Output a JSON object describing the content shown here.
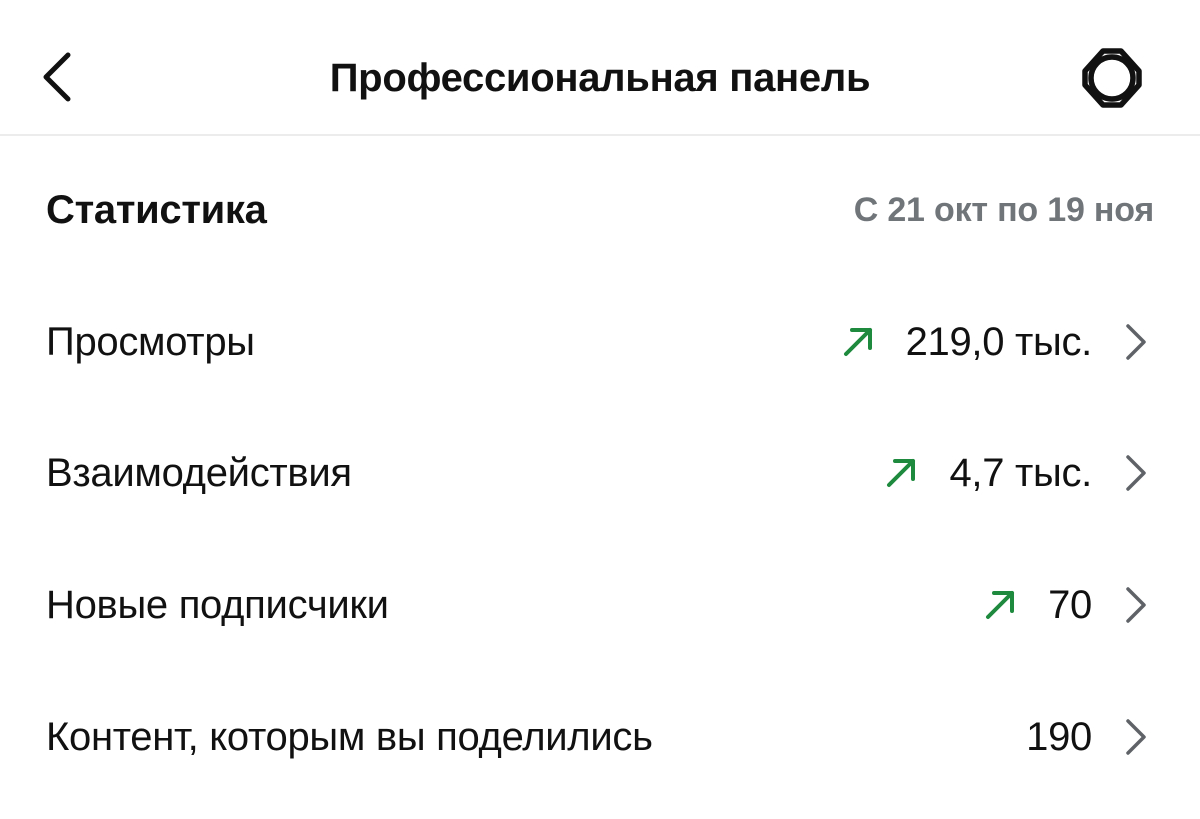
{
  "header": {
    "title": "Профессиональная панель",
    "back_icon": "chevron-left-icon",
    "settings_icon": "gear-icon"
  },
  "stats": {
    "title": "Статистика",
    "date_range": "С 21 окт по 19 ноя",
    "rows": [
      {
        "label": "Просмотры",
        "value": "219,0 тыс.",
        "trend": "up"
      },
      {
        "label": "Взаимодействия",
        "value": "4,7 тыс.",
        "trend": "up"
      },
      {
        "label": "Новые подписчики",
        "value": "70",
        "trend": "up"
      },
      {
        "label": "Контент, которым вы поделились",
        "value": "190",
        "trend": "none"
      }
    ]
  },
  "colors": {
    "trend_up": "#1e8a3e",
    "muted_text": "#70757a",
    "chevron": "#5f6368",
    "text": "#111111"
  }
}
